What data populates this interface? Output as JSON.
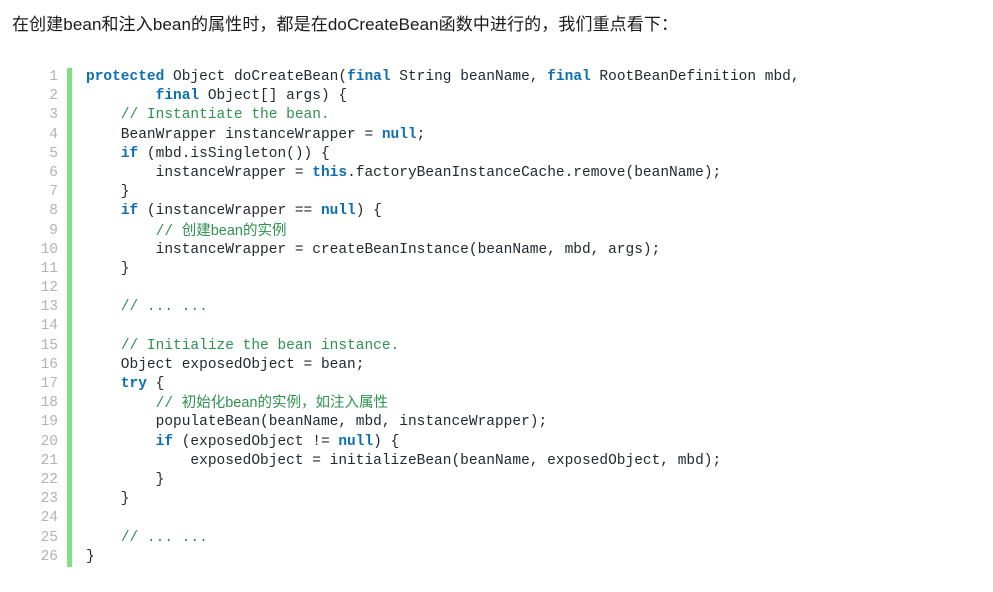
{
  "intro": {
    "text": "在创建bean和注入bean的属性时，都是在doCreateBean函数中进行的，我们重点看下："
  },
  "colors": {
    "background": "#ffffff",
    "keyword": "#0b6fb0",
    "comment": "#2e9150",
    "plain": "#24292e",
    "line_number": "#b3b3b3",
    "gutter_bar": "#7ee07e"
  },
  "code_block": {
    "language": "java",
    "line_numbers": [
      1,
      2,
      3,
      4,
      5,
      6,
      7,
      8,
      9,
      10,
      11,
      12,
      13,
      14,
      15,
      16,
      17,
      18,
      19,
      20,
      21,
      22,
      23,
      24,
      25,
      26
    ],
    "lines": [
      [
        {
          "t": "kw",
          "v": "protected"
        },
        {
          "t": "pln",
          "v": " Object doCreateBean("
        },
        {
          "t": "kw",
          "v": "final"
        },
        {
          "t": "pln",
          "v": " String beanName, "
        },
        {
          "t": "kw",
          "v": "final"
        },
        {
          "t": "pln",
          "v": " RootBeanDefinition mbd,"
        }
      ],
      [
        {
          "t": "pln",
          "v": "        "
        },
        {
          "t": "kw",
          "v": "final"
        },
        {
          "t": "pln",
          "v": " Object[] args) {"
        }
      ],
      [
        {
          "t": "pln",
          "v": "    "
        },
        {
          "t": "cmt",
          "v": "// Instantiate the bean."
        }
      ],
      [
        {
          "t": "pln",
          "v": "    BeanWrapper instanceWrapper = "
        },
        {
          "t": "kw",
          "v": "null"
        },
        {
          "t": "pln",
          "v": ";"
        }
      ],
      [
        {
          "t": "pln",
          "v": "    "
        },
        {
          "t": "kw",
          "v": "if"
        },
        {
          "t": "pln",
          "v": " (mbd.isSingleton()) {"
        }
      ],
      [
        {
          "t": "pln",
          "v": "        instanceWrapper = "
        },
        {
          "t": "kw",
          "v": "this"
        },
        {
          "t": "pln",
          "v": ".factoryBeanInstanceCache.remove(beanName);"
        }
      ],
      [
        {
          "t": "pln",
          "v": "    }"
        }
      ],
      [
        {
          "t": "pln",
          "v": "    "
        },
        {
          "t": "kw",
          "v": "if"
        },
        {
          "t": "pln",
          "v": " (instanceWrapper == "
        },
        {
          "t": "kw",
          "v": "null"
        },
        {
          "t": "pln",
          "v": ") {"
        }
      ],
      [
        {
          "t": "pln",
          "v": "        "
        },
        {
          "t": "cmt",
          "v": "// "
        },
        {
          "t": "cmt-cn",
          "v": "创建bean的实例"
        }
      ],
      [
        {
          "t": "pln",
          "v": "        instanceWrapper = createBeanInstance(beanName, mbd, args);"
        }
      ],
      [
        {
          "t": "pln",
          "v": "    }"
        }
      ],
      [],
      [
        {
          "t": "pln",
          "v": "    "
        },
        {
          "t": "cmt",
          "v": "// ... ..."
        }
      ],
      [],
      [
        {
          "t": "pln",
          "v": "    "
        },
        {
          "t": "cmt",
          "v": "// Initialize the bean instance."
        }
      ],
      [
        {
          "t": "pln",
          "v": "    Object exposedObject = bean;"
        }
      ],
      [
        {
          "t": "pln",
          "v": "    "
        },
        {
          "t": "kw",
          "v": "try"
        },
        {
          "t": "pln",
          "v": " {"
        }
      ],
      [
        {
          "t": "pln",
          "v": "        "
        },
        {
          "t": "cmt",
          "v": "// "
        },
        {
          "t": "cmt-cn",
          "v": "初始化bean的实例，如注入属性"
        }
      ],
      [
        {
          "t": "pln",
          "v": "        populateBean(beanName, mbd, instanceWrapper);"
        }
      ],
      [
        {
          "t": "pln",
          "v": "        "
        },
        {
          "t": "kw",
          "v": "if"
        },
        {
          "t": "pln",
          "v": " (exposedObject != "
        },
        {
          "t": "kw",
          "v": "null"
        },
        {
          "t": "pln",
          "v": ") {"
        }
      ],
      [
        {
          "t": "pln",
          "v": "            exposedObject = initializeBean(beanName, exposedObject, mbd);"
        }
      ],
      [
        {
          "t": "pln",
          "v": "        }"
        }
      ],
      [
        {
          "t": "pln",
          "v": "    }"
        }
      ],
      [],
      [
        {
          "t": "pln",
          "v": "    "
        },
        {
          "t": "cmt",
          "v": "// ... ..."
        }
      ],
      [
        {
          "t": "pln",
          "v": "}"
        }
      ]
    ]
  }
}
